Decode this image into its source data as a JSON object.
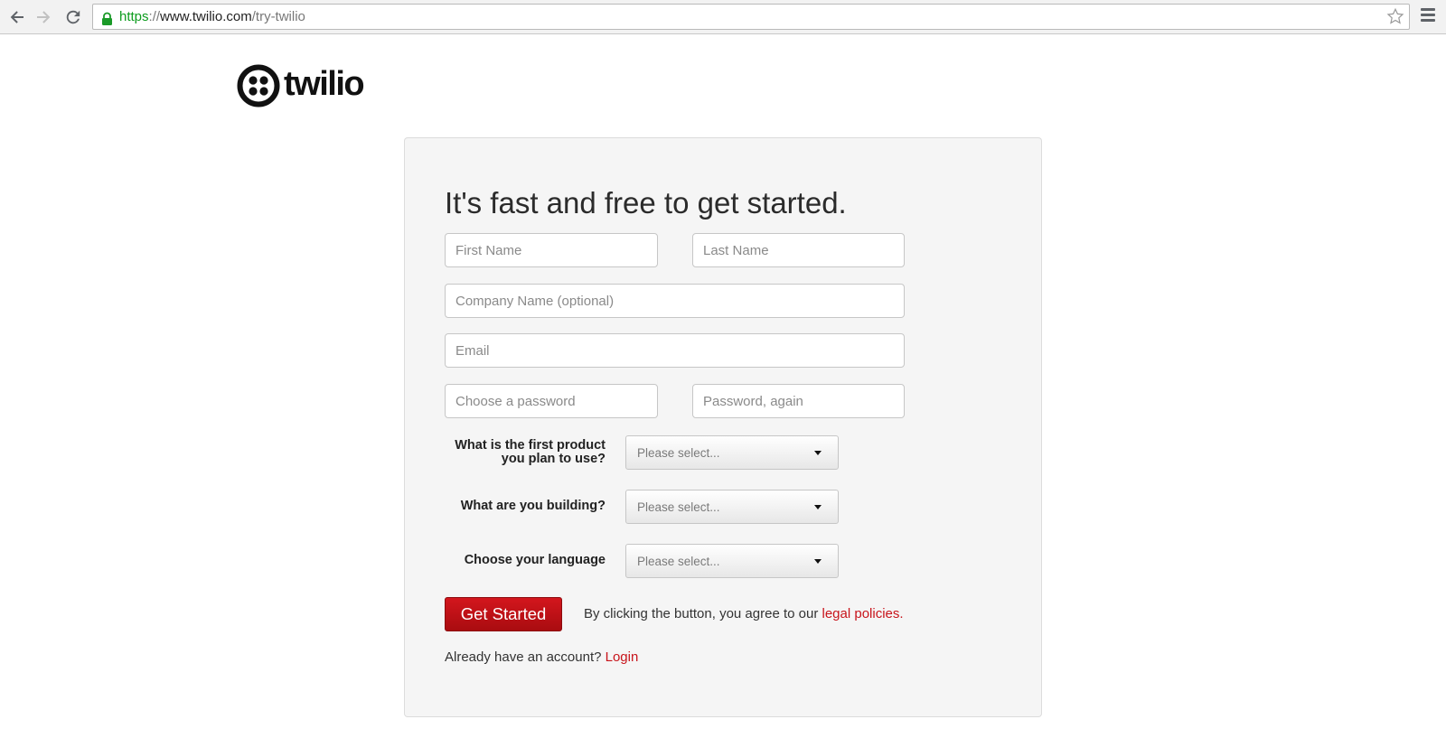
{
  "browser": {
    "url_scheme": "https",
    "url_separator": "://",
    "url_host": "www.twilio.com",
    "url_path": "/try-twilio"
  },
  "brand": {
    "logo_text": "twilio",
    "brand_color": "#c8141b"
  },
  "form": {
    "headline": "It's fast and free to get started.",
    "first_name_placeholder": "First Name",
    "last_name_placeholder": "Last Name",
    "company_placeholder": "Company Name (optional)",
    "email_placeholder": "Email",
    "password_placeholder": "Choose a password",
    "password_again_placeholder": "Password, again",
    "questions": [
      {
        "label_line1": "What is the first product",
        "label_line2": "you plan to use?",
        "value": "Please select..."
      },
      {
        "label": "What are you building?",
        "value": "Please select..."
      },
      {
        "label": "Choose your language",
        "value": "Please select..."
      }
    ],
    "submit_label": "Get Started",
    "agree_text": "By clicking the button, you agree to our ",
    "legal_link": "legal policies",
    "agree_suffix": ".",
    "login_prompt": "Already have an account? ",
    "login_link": "Login"
  }
}
